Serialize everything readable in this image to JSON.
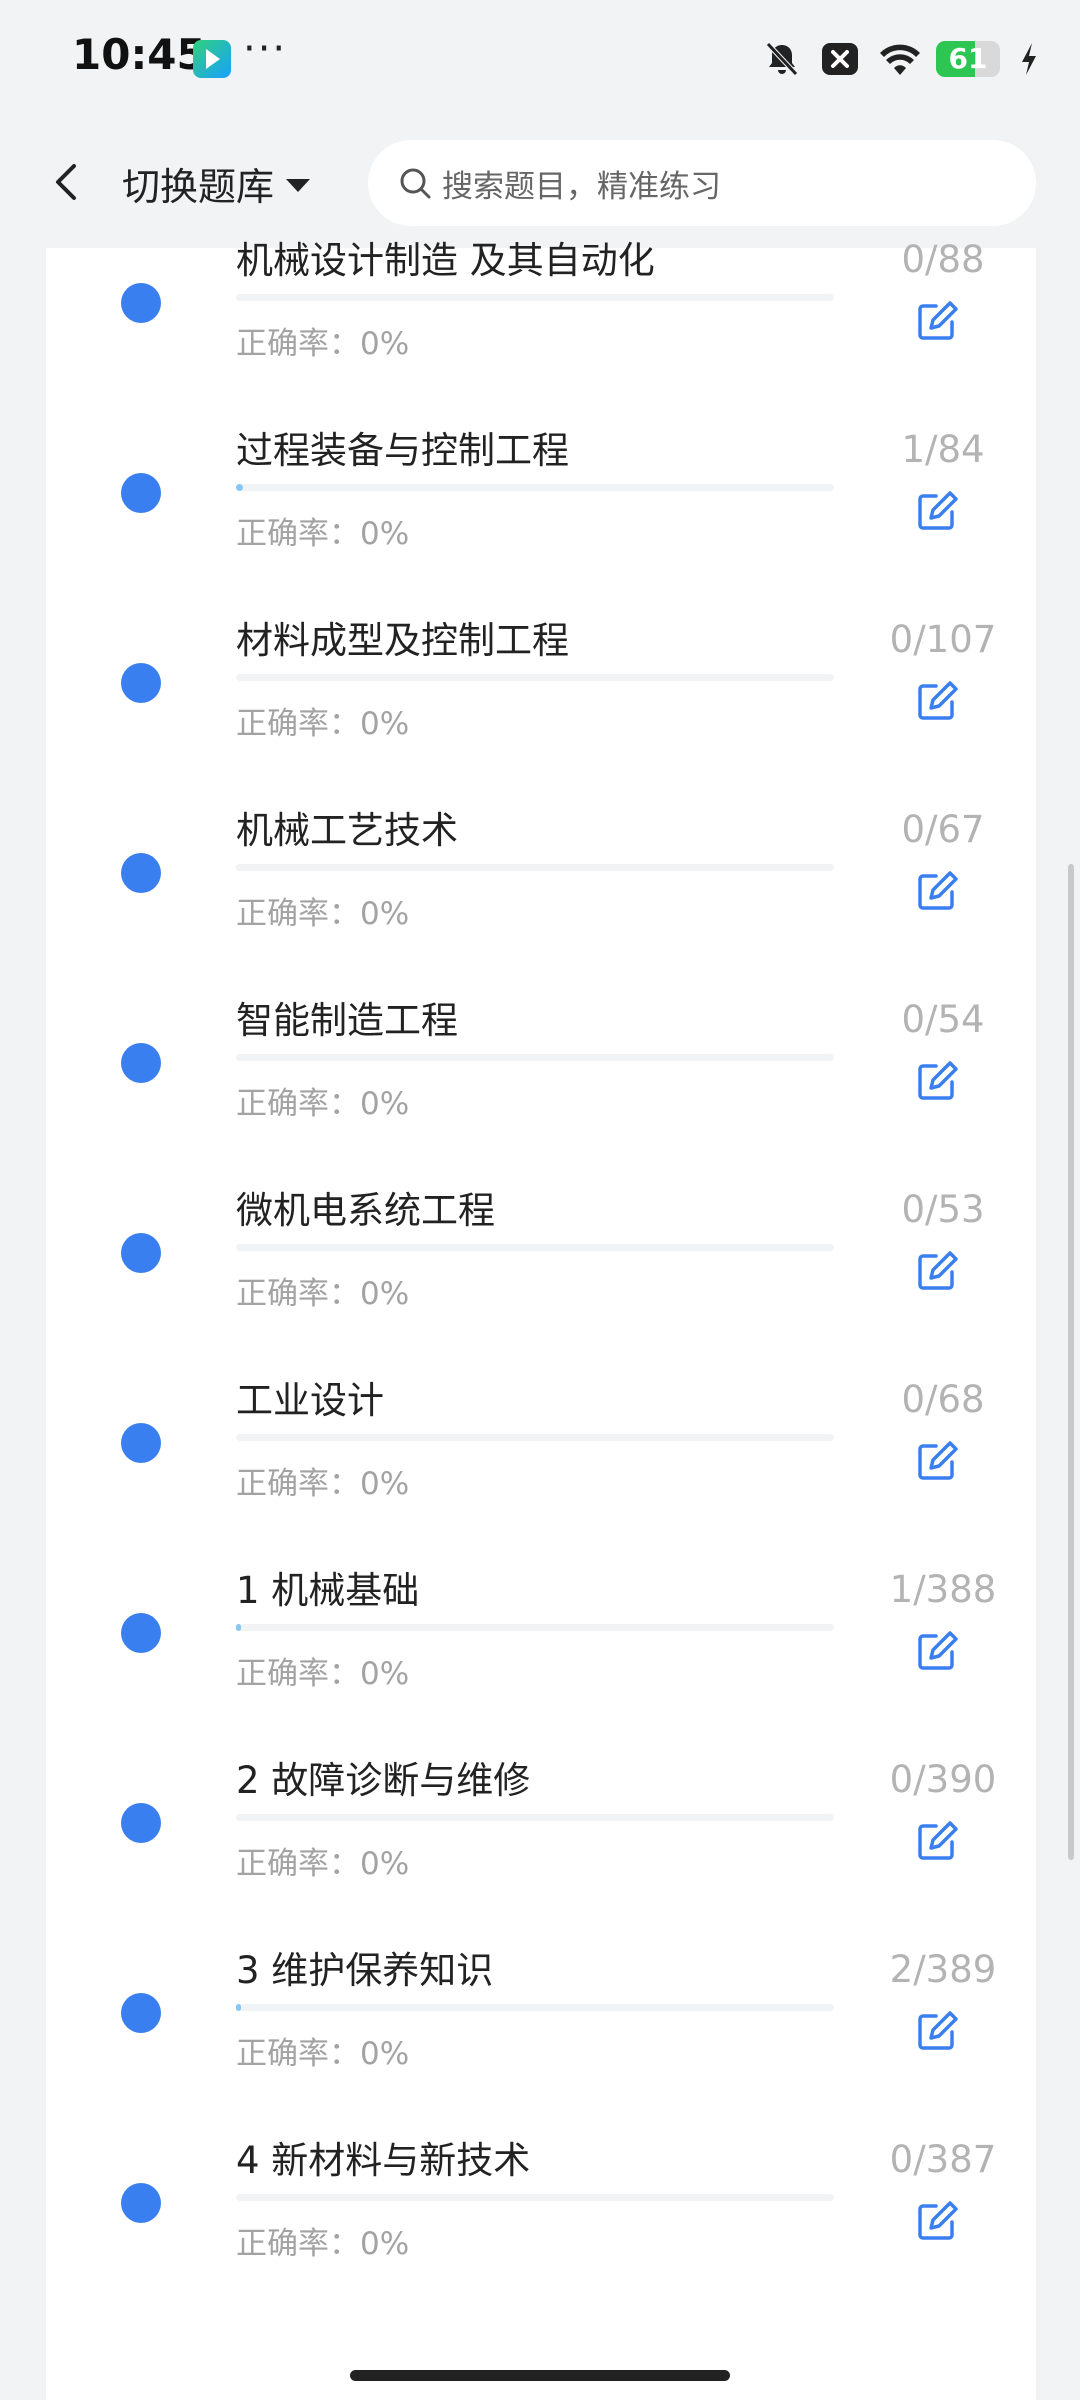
{
  "status_bar": {
    "time": "10:45",
    "dots": "···",
    "battery": "61",
    "icons": [
      "app-icon",
      "bell-off-icon",
      "x-box-icon",
      "wifi-icon",
      "battery-icon",
      "bolt-icon"
    ]
  },
  "header": {
    "bank_switch_label": "切换题库",
    "search_placeholder": "搜索题目，精准练习"
  },
  "accuracy_prefix": "正确率：",
  "colors": {
    "accent": "#3a7ff0",
    "progress": "#86c8f5",
    "muted": "#a3a3a3"
  },
  "items": [
    {
      "title": "机械设计制造 及其自动化",
      "accuracy": "正确率：0%",
      "count": "0/88",
      "progress": 0
    },
    {
      "title": "过程装备与控制工程",
      "accuracy": "正确率：0%",
      "count": "1/84",
      "progress": 0.0119
    },
    {
      "title": "材料成型及控制工程",
      "accuracy": "正确率：0%",
      "count": "0/107",
      "progress": 0
    },
    {
      "title": "机械工艺技术",
      "accuracy": "正确率：0%",
      "count": "0/67",
      "progress": 0
    },
    {
      "title": "智能制造工程",
      "accuracy": "正确率：0%",
      "count": "0/54",
      "progress": 0
    },
    {
      "title": "微机电系统工程",
      "accuracy": "正确率：0%",
      "count": "0/53",
      "progress": 0
    },
    {
      "title": "工业设计",
      "accuracy": "正确率：0%",
      "count": "0/68",
      "progress": 0
    },
    {
      "title": "1 机械基础",
      "accuracy": "正确率：0%",
      "count": "1/388",
      "progress": 0.0026
    },
    {
      "title": "2 故障诊断与维修",
      "accuracy": "正确率：0%",
      "count": "0/390",
      "progress": 0
    },
    {
      "title": "3 维护保养知识",
      "accuracy": "正确率：0%",
      "count": "2/389",
      "progress": 0.0051
    },
    {
      "title": "4 新材料与新技术",
      "accuracy": "正确率：0%",
      "count": "0/387",
      "progress": 0
    }
  ]
}
